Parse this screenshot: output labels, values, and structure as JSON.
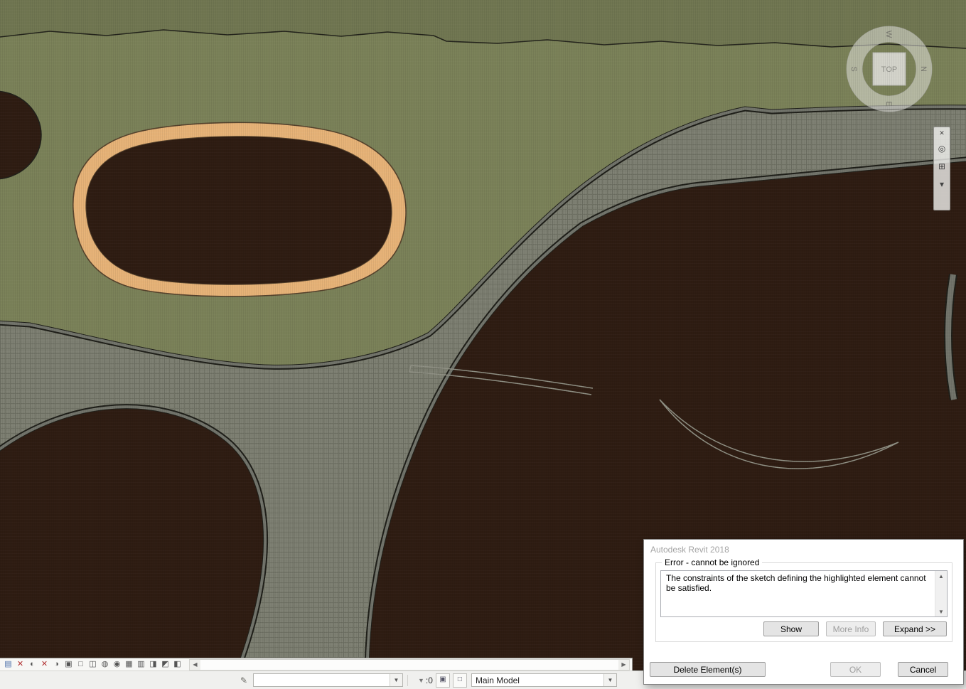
{
  "window": {
    "title": "Autodesk Revit 2018"
  },
  "colors": {
    "terrain_green": "#7a8158",
    "soil_brown": "#2e1c12",
    "path_gray": "#7d7f72",
    "path_line": "#6e7063",
    "curb_gray": "#71736a",
    "curb_dark": "#1e1e18",
    "highlight_orange": "#e6b277"
  },
  "viewcube": {
    "top_label": "TOP",
    "north": "N",
    "south": "S",
    "east": "E",
    "west": "W"
  },
  "navigation_bar": {
    "icons": [
      "close-icon",
      "steering-wheel-icon",
      "zoom-region-icon",
      "chevron-down-icon"
    ]
  },
  "view_control_bar": {
    "icons": [
      "scale-icon",
      "detail-level-icon",
      "visual-style-icon",
      "sun-path-icon",
      "shadows-icon",
      "crop-view-icon",
      "show-crop-region-icon",
      "temporary-hide-isolate-icon",
      "reveal-hidden-elements-icon",
      "temporary-view-properties-icon",
      "show-constraints-icon",
      "worksharing-display-icon",
      "analytical-model-icon",
      "highlight-displacement-icon",
      "reveal-obstacles-icon"
    ],
    "scroll_left": "◀",
    "scroll_right": "▶"
  },
  "status_bar": {
    "workset_value": "",
    "selection_filter_count": ":0",
    "design_option_value": "Main Model"
  },
  "dialog": {
    "title": "Autodesk Revit 2018",
    "group_label": "Error - cannot be ignored",
    "message": "The constraints of the sketch defining the highlighted element cannot be satisfied.",
    "buttons": {
      "show": "Show",
      "more_info": "More Info",
      "expand": "Expand >>",
      "delete": "Delete Element(s)",
      "ok": "OK",
      "cancel": "Cancel"
    }
  }
}
